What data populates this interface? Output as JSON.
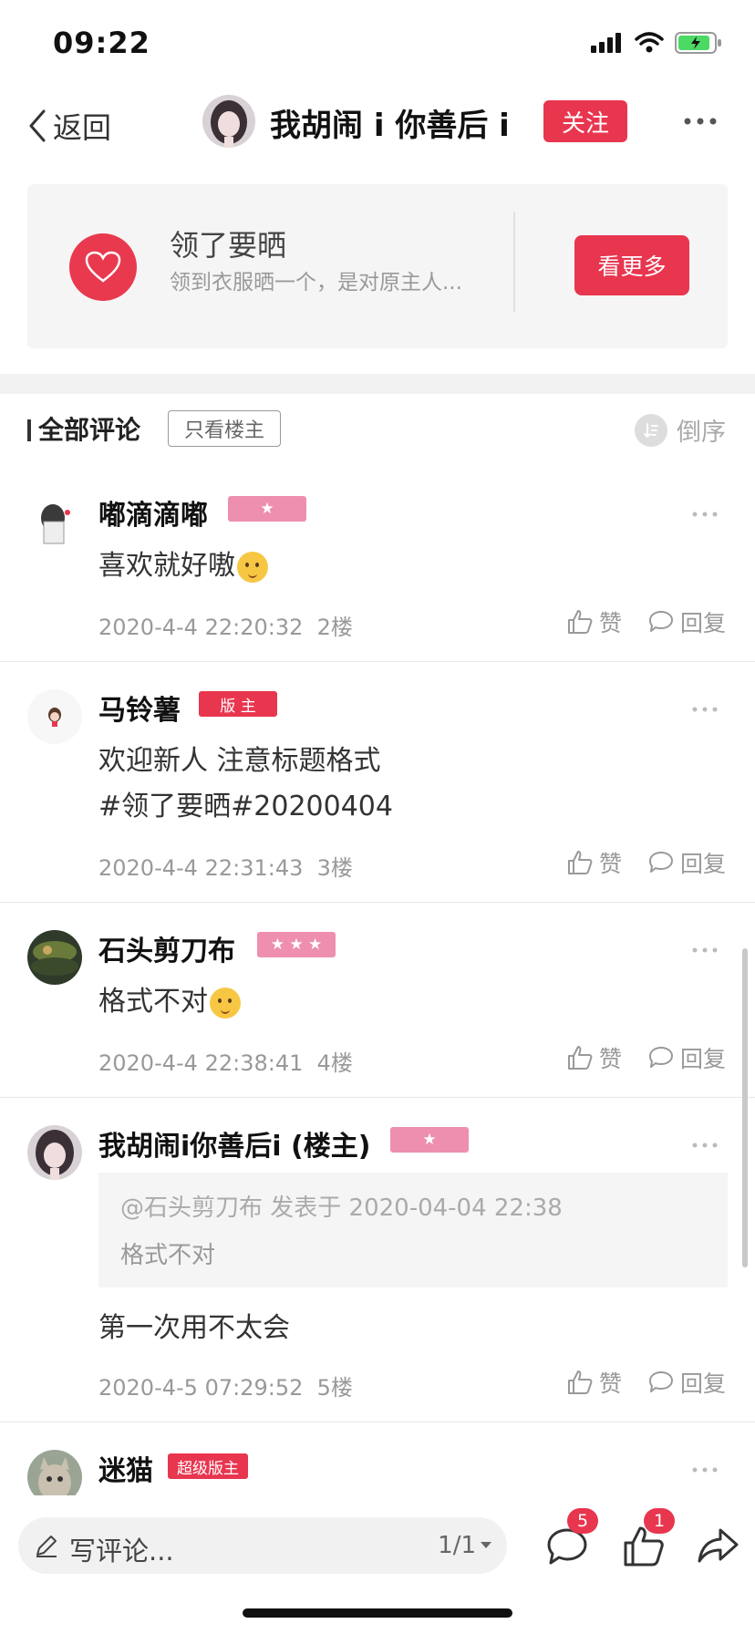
{
  "status_bar": {
    "time": "09:22"
  },
  "nav": {
    "back_label": "返回",
    "title": "我胡闹 i 你善后 i",
    "follow_label": "关注"
  },
  "forum": {
    "name": "领了要晒",
    "description": "领到衣服晒一个，是对原主人...",
    "see_more_label": "看更多"
  },
  "comments_header": {
    "title": "全部评论",
    "only_op_label": "只看楼主",
    "sort_label": "倒序"
  },
  "comments": [
    {
      "username": "嘟滴滴嘟",
      "badge": "★",
      "text": "喜欢就好嗷",
      "date": "2020-4-4 22:20:32",
      "floor": "2楼",
      "like_label": "赞",
      "reply_label": "回复"
    },
    {
      "username": "马铃薯",
      "badge": "版 主",
      "text_line1": "欢迎新人 注意标题格式",
      "text_line2": "#领了要晒#20200404",
      "date": "2020-4-4 22:31:43",
      "floor": "3楼",
      "like_label": "赞",
      "reply_label": "回复"
    },
    {
      "username": "石头剪刀布",
      "badge": "★ ★ ★",
      "text": "格式不对",
      "date": "2020-4-4 22:38:41",
      "floor": "4楼",
      "like_label": "赞",
      "reply_label": "回复"
    },
    {
      "username": "我胡闹i你善后i (楼主)",
      "badge": "★",
      "quote_header": "@石头剪刀布 发表于 2020-04-04 22:38",
      "quote_text": "格式不对",
      "text": "第一次用不太会",
      "date": "2020-4-5 07:29:52",
      "floor": "5楼",
      "like_label": "赞",
      "reply_label": "回复"
    },
    {
      "username": "迷猫",
      "badge": "超级版主"
    }
  ],
  "bottom_bar": {
    "input_placeholder": "写评论...",
    "page_indicator": "1/1",
    "comment_count": "5",
    "like_count": "1"
  },
  "colors": {
    "accent": "#e8364f",
    "badge_pink": "#ee8fb0"
  }
}
